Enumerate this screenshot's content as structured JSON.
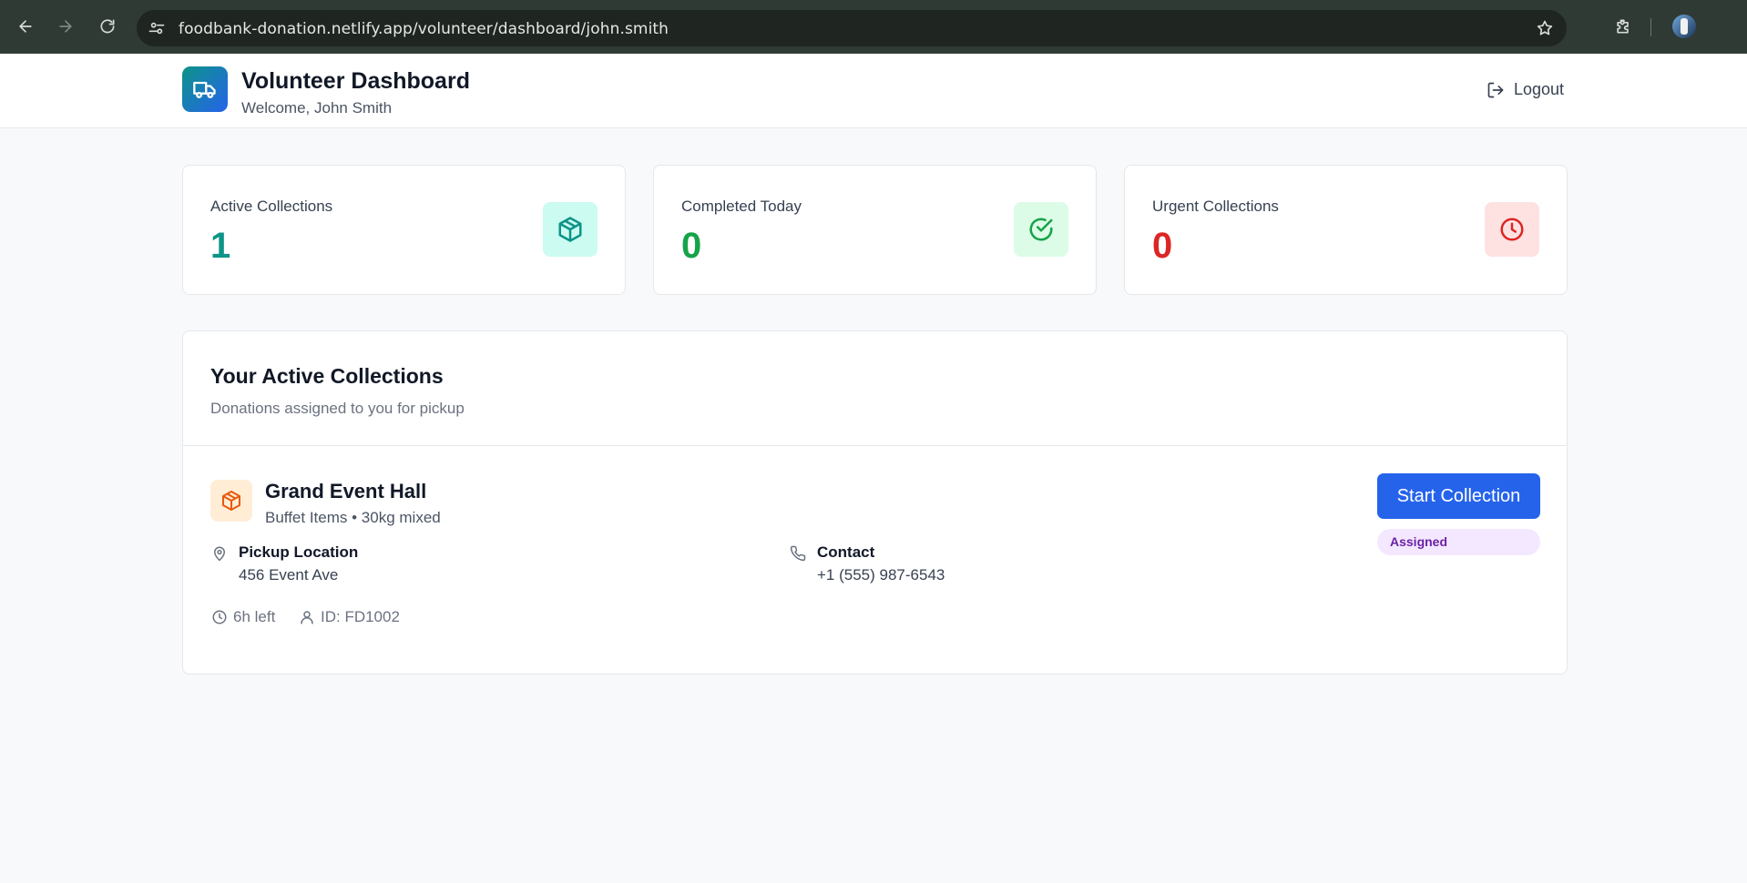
{
  "browser": {
    "url": "foodbank-donation.netlify.app/volunteer/dashboard/john.smith"
  },
  "header": {
    "title": "Volunteer Dashboard",
    "welcome": "Welcome, John Smith",
    "logout_label": "Logout",
    "logo_icon": "truck-icon"
  },
  "stats": [
    {
      "label": "Active Collections",
      "value": "1",
      "color": "#0d9488",
      "icon": "package-icon",
      "icon_bg": "#ccfbf1"
    },
    {
      "label": "Completed Today",
      "value": "0",
      "color": "#16a34a",
      "icon": "check-circle-icon",
      "icon_bg": "#dcfce7"
    },
    {
      "label": "Urgent Collections",
      "value": "0",
      "color": "#dc2626",
      "icon": "clock-icon",
      "icon_bg": "#fee2e2"
    }
  ],
  "collections": {
    "title": "Your Active Collections",
    "subtitle": "Donations assigned to you for pickup",
    "items": [
      {
        "name": "Grand Event Hall",
        "description": "Buffet Items • 30kg mixed",
        "pickup_label": "Pickup Location",
        "pickup_value": "456 Event Ave",
        "contact_label": "Contact",
        "contact_value": "+1 (555) 987-6543",
        "time_left": "6h left",
        "id_text": "ID: FD1002",
        "action_label": "Start Collection",
        "status": "Assigned"
      }
    ]
  }
}
